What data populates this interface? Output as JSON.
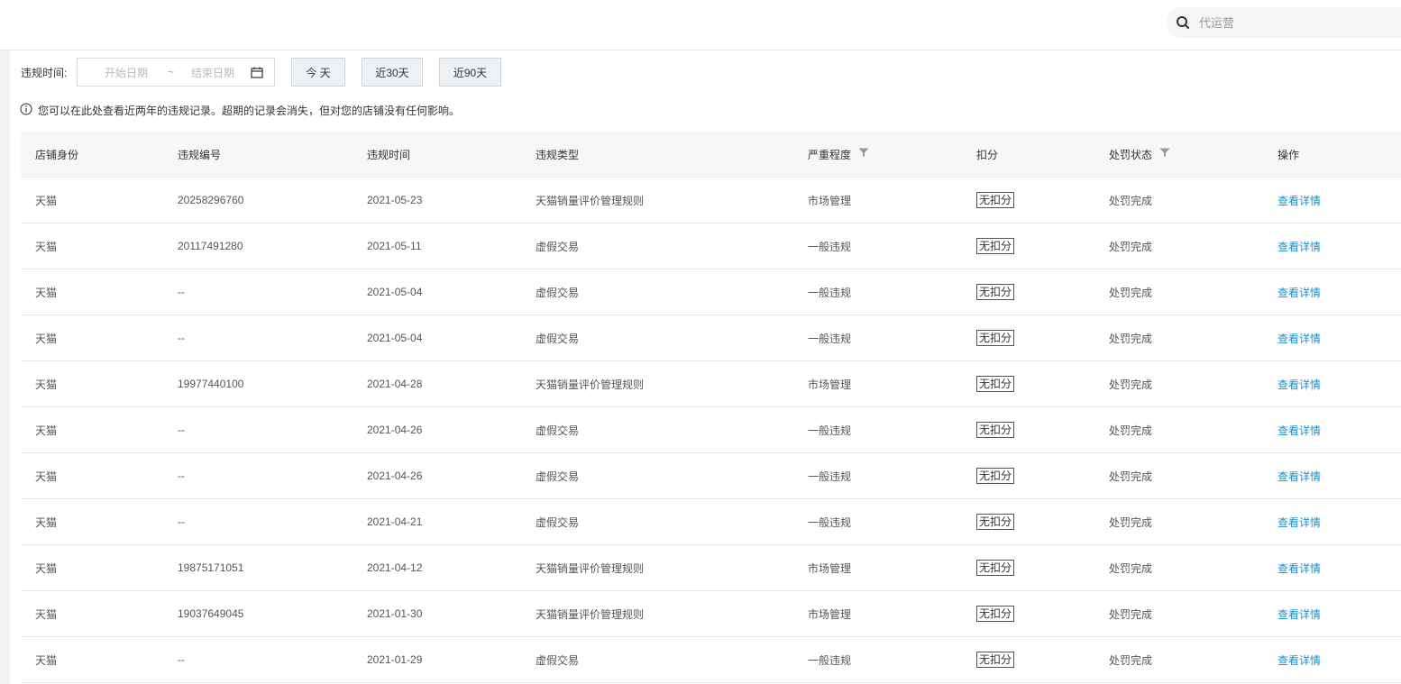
{
  "search": {
    "placeholder": "代运营"
  },
  "filter": {
    "label": "违规时间:",
    "start_placeholder": "开始日期",
    "separator": "~",
    "end_placeholder": "结束日期",
    "btn_today": "今 天",
    "btn_30": "近30天",
    "btn_90": "近90天"
  },
  "notice": "您可以在此处查看近两年的违规记录。超期的记录会消失，但对您的店铺没有任何影响。",
  "table": {
    "headers": [
      "店铺身份",
      "违规编号",
      "违规时间",
      "违规类型",
      "严重程度",
      "扣分",
      "处罚状态",
      "操作"
    ],
    "rows": [
      {
        "shop": "天猫",
        "id": "20258296760",
        "date": "2021-05-23",
        "type": "天猫销量评价管理规则",
        "severity": "市场管理",
        "points": "无扣分",
        "status": "处罚完成",
        "action": "查看详情"
      },
      {
        "shop": "天猫",
        "id": "20117491280",
        "date": "2021-05-11",
        "type": "虚假交易",
        "severity": "一般违规",
        "points": "无扣分",
        "status": "处罚完成",
        "action": "查看详情"
      },
      {
        "shop": "天猫",
        "id": "--",
        "date": "2021-05-04",
        "type": "虚假交易",
        "severity": "一般违规",
        "points": "无扣分",
        "status": "处罚完成",
        "action": "查看详情"
      },
      {
        "shop": "天猫",
        "id": "--",
        "date": "2021-05-04",
        "type": "虚假交易",
        "severity": "一般违规",
        "points": "无扣分",
        "status": "处罚完成",
        "action": "查看详情"
      },
      {
        "shop": "天猫",
        "id": "19977440100",
        "date": "2021-04-28",
        "type": "天猫销量评价管理规则",
        "severity": "市场管理",
        "points": "无扣分",
        "status": "处罚完成",
        "action": "查看详情"
      },
      {
        "shop": "天猫",
        "id": "--",
        "date": "2021-04-26",
        "type": "虚假交易",
        "severity": "一般违规",
        "points": "无扣分",
        "status": "处罚完成",
        "action": "查看详情"
      },
      {
        "shop": "天猫",
        "id": "--",
        "date": "2021-04-26",
        "type": "虚假交易",
        "severity": "一般违规",
        "points": "无扣分",
        "status": "处罚完成",
        "action": "查看详情"
      },
      {
        "shop": "天猫",
        "id": "--",
        "date": "2021-04-21",
        "type": "虚假交易",
        "severity": "一般违规",
        "points": "无扣分",
        "status": "处罚完成",
        "action": "查看详情"
      },
      {
        "shop": "天猫",
        "id": "19875171051",
        "date": "2021-04-12",
        "type": "天猫销量评价管理规则",
        "severity": "市场管理",
        "points": "无扣分",
        "status": "处罚完成",
        "action": "查看详情"
      },
      {
        "shop": "天猫",
        "id": "19037649045",
        "date": "2021-01-30",
        "type": "天猫销量评价管理规则",
        "severity": "市场管理",
        "points": "无扣分",
        "status": "处罚完成",
        "action": "查看详情"
      },
      {
        "shop": "天猫",
        "id": "--",
        "date": "2021-01-29",
        "type": "虚假交易",
        "severity": "一般违规",
        "points": "无扣分",
        "status": "处罚完成",
        "action": "查看详情"
      }
    ]
  },
  "colors": {
    "link": "#1a8fc9",
    "header_bg": "#f7f7f7",
    "button_bg": "#eef1f4"
  }
}
